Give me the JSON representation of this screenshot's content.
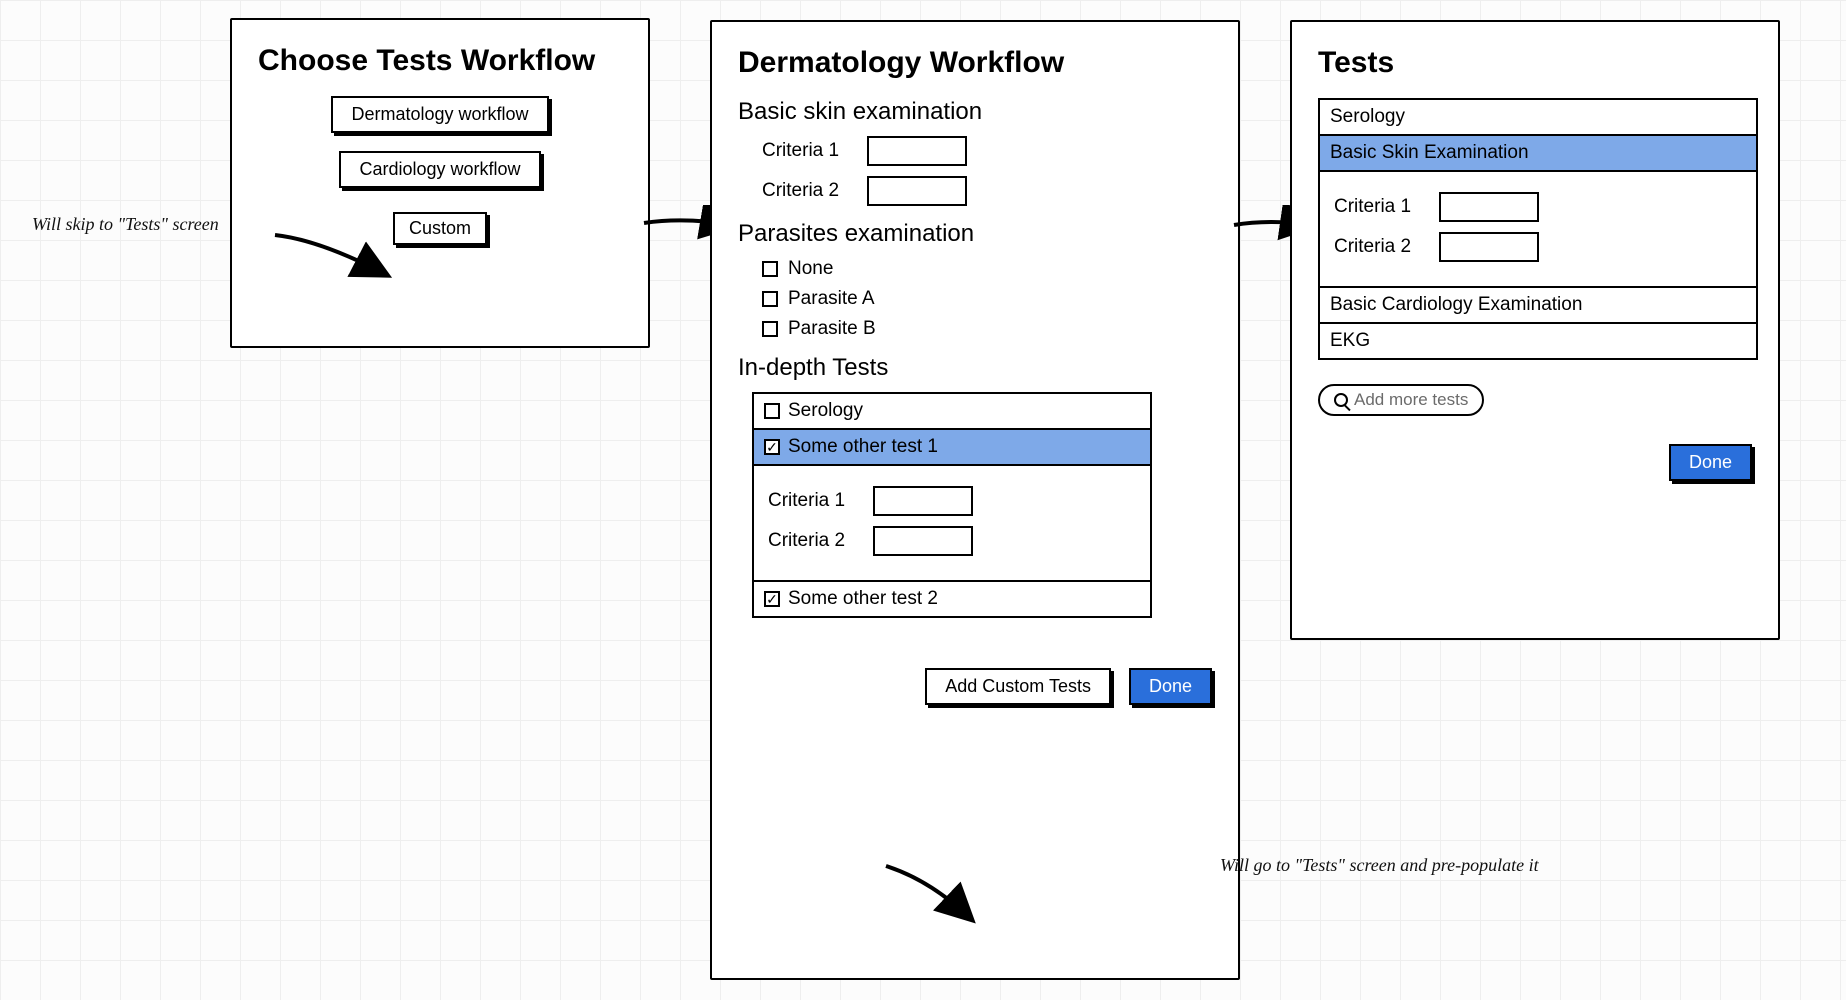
{
  "panel1": {
    "title": "Choose Tests Workflow",
    "buttons": {
      "dermatology": "Dermatology workflow",
      "cardiology": "Cardiology workflow",
      "custom": "Custom"
    }
  },
  "annotation1": "Will skip to \"Tests\" screen",
  "panel2": {
    "title": "Dermatology Workflow",
    "basic_skin": {
      "heading": "Basic skin examination",
      "criteria1_label": "Criteria 1",
      "criteria1_value": "",
      "criteria2_label": "Criteria 2",
      "criteria2_value": ""
    },
    "parasites": {
      "heading": "Parasites examination",
      "options": [
        {
          "label": "None",
          "checked": false
        },
        {
          "label": "Parasite A",
          "checked": false
        },
        {
          "label": "Parasite B",
          "checked": false
        }
      ]
    },
    "indepth": {
      "heading": "In-depth Tests",
      "rows": [
        {
          "label": "Serology",
          "checked": false,
          "highlight": false,
          "expanded": false
        },
        {
          "label": "Some other test 1",
          "checked": true,
          "highlight": true,
          "expanded": true,
          "criteria1_label": "Criteria 1",
          "criteria1_value": "",
          "criteria2_label": "Criteria 2",
          "criteria2_value": ""
        },
        {
          "label": "Some other test 2",
          "checked": true,
          "highlight": false,
          "expanded": false
        }
      ]
    },
    "add_custom": "Add Custom Tests",
    "done": "Done"
  },
  "annotation2": "Will go to \"Tests\" screen and pre-populate it",
  "panel3": {
    "title": "Tests",
    "list": [
      {
        "label": "Serology",
        "highlight": false,
        "expanded": false
      },
      {
        "label": "Basic Skin Examination",
        "highlight": true,
        "expanded": true,
        "criteria1_label": "Criteria 1",
        "criteria1_value": "",
        "criteria2_label": "Criteria 2",
        "criteria2_value": ""
      },
      {
        "label": "Basic Cardiology Examination",
        "highlight": false,
        "expanded": false
      },
      {
        "label": "EKG",
        "highlight": false,
        "expanded": false
      }
    ],
    "add_more": "Add more tests",
    "done": "Done"
  }
}
